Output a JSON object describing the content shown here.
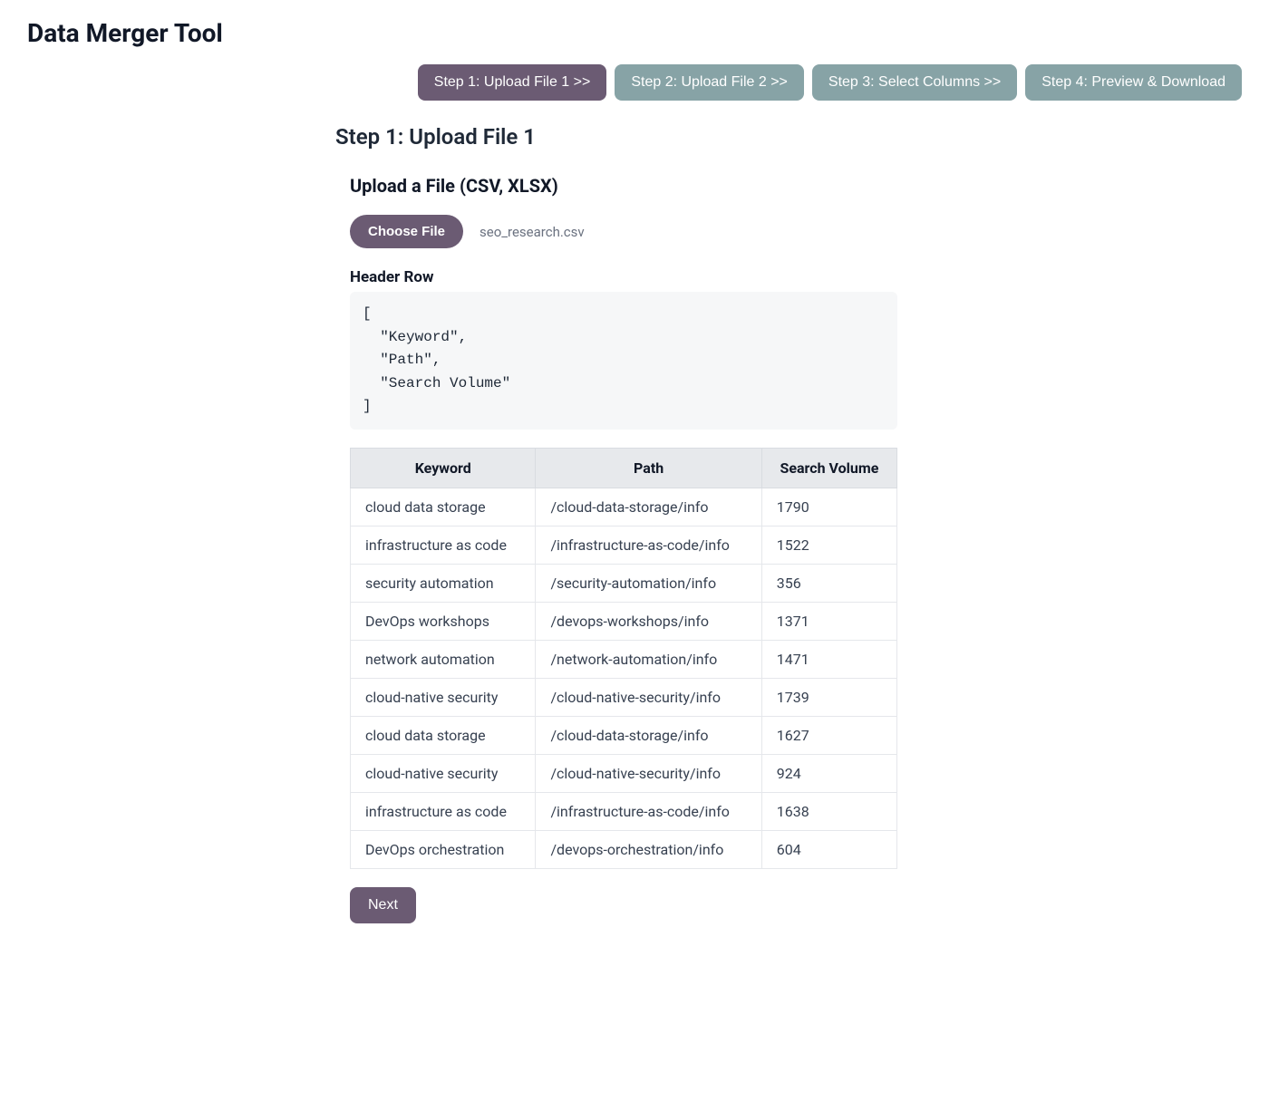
{
  "title": "Data Merger Tool",
  "steps": [
    {
      "label": "Step 1: Upload File 1  >>",
      "active": true
    },
    {
      "label": "Step 2: Upload File 2  >>",
      "active": false
    },
    {
      "label": "Step 3: Select Columns  >>",
      "active": false
    },
    {
      "label": "Step 4: Preview & Download",
      "active": false
    }
  ],
  "step_heading": "Step 1: Upload File 1",
  "upload_section_title": "Upload a File (CSV, XLSX)",
  "choose_file_label": "Choose File",
  "selected_filename": "seo_research.csv",
  "header_row_label": "Header Row",
  "header_row_json": "[\n  \"Keyword\",\n  \"Path\",\n  \"Search Volume\"\n]",
  "table": {
    "columns": [
      "Keyword",
      "Path",
      "Search Volume"
    ],
    "rows": [
      [
        "cloud data storage",
        "/cloud-data-storage/info",
        "1790"
      ],
      [
        "infrastructure as code",
        "/infrastructure-as-code/info",
        "1522"
      ],
      [
        "security automation",
        "/security-automation/info",
        "356"
      ],
      [
        "DevOps workshops",
        "/devops-workshops/info",
        "1371"
      ],
      [
        "network automation",
        "/network-automation/info",
        "1471"
      ],
      [
        "cloud-native security",
        "/cloud-native-security/info",
        "1739"
      ],
      [
        "cloud data storage",
        "/cloud-data-storage/info",
        "1627"
      ],
      [
        "cloud-native security",
        "/cloud-native-security/info",
        "924"
      ],
      [
        "infrastructure as code",
        "/infrastructure-as-code/info",
        "1638"
      ],
      [
        "DevOps orchestration",
        "/devops-orchestration/info",
        "604"
      ]
    ]
  },
  "next_label": "Next"
}
